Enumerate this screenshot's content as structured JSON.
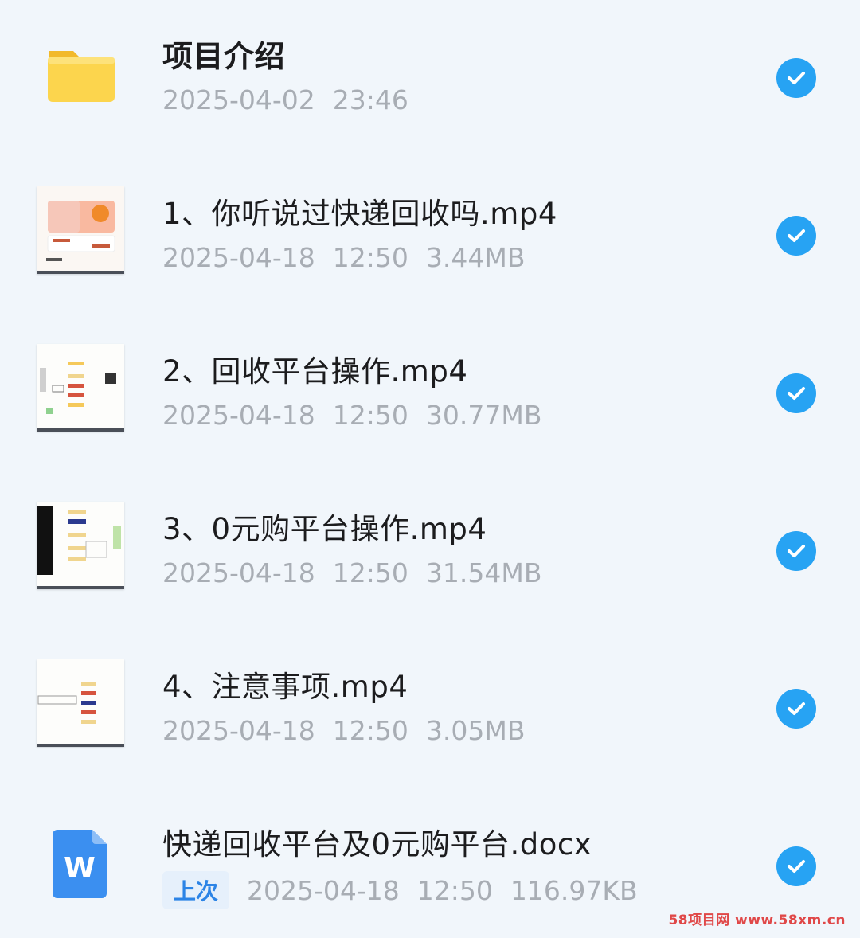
{
  "files": [
    {
      "name": "项目介绍",
      "date": "2025-04-02",
      "time": "23:46",
      "size": "",
      "type": "folder-icon"
    },
    {
      "name": "1、你听说过快递回收吗.mp4",
      "date": "2025-04-18",
      "time": "12:50",
      "size": "3.44MB",
      "type": "video-thumbnail"
    },
    {
      "name": "2、回收平台操作.mp4",
      "date": "2025-04-18",
      "time": "12:50",
      "size": "30.77MB",
      "type": "video-thumbnail"
    },
    {
      "name": "3、0元购平台操作.mp4",
      "date": "2025-04-18",
      "time": "12:50",
      "size": "31.54MB",
      "type": "video-thumbnail"
    },
    {
      "name": "4、注意事项.mp4",
      "date": "2025-04-18",
      "time": "12:50",
      "size": "3.05MB",
      "type": "video-thumbnail"
    },
    {
      "name": "快递回收平台及0元购平台.docx",
      "badge": "上次",
      "date": "2025-04-18",
      "time": "12:50",
      "size": "116.97KB",
      "type": "word-doc-icon"
    }
  ],
  "watermark": "58项目网 www.58xm.cn",
  "colors": {
    "background": "#f1f6fb",
    "check": "#27a3f3",
    "folder": "#fcd54d",
    "word": "#3b8ff0",
    "meta_text": "#a8adb4"
  }
}
